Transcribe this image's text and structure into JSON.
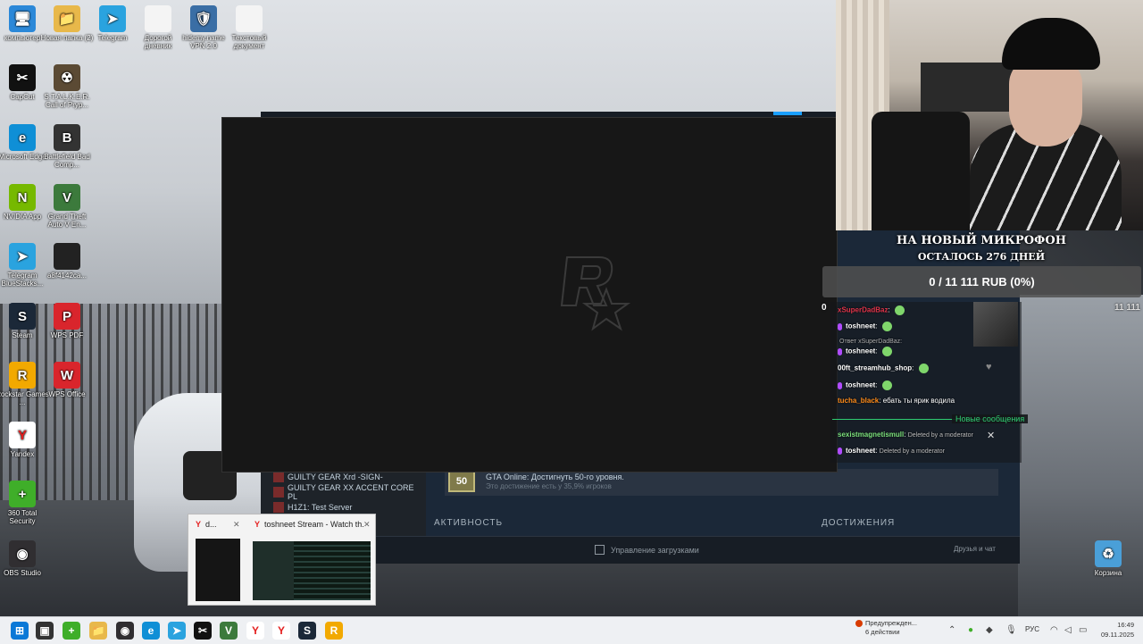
{
  "desktop": {
    "icons": [
      {
        "label": "компьютер",
        "symbol": "🖥",
        "bg": "#2b88d8"
      },
      {
        "label": "Новая папка (2)",
        "symbol": "📁",
        "bg": "#e8b84a"
      },
      {
        "label": "Telegram",
        "symbol": "➤",
        "bg": "#2aa3df"
      },
      {
        "label": "Дорогой дневник",
        "symbol": "",
        "bg": "#f4f4f4"
      },
      {
        "label": "hidemy.name VPN 2.0",
        "symbol": "🛡",
        "bg": "#3a6ea5"
      },
      {
        "label": "Текстовый документ",
        "symbol": "",
        "bg": "#f4f4f4"
      },
      {
        "label": "CapCut",
        "symbol": "✂",
        "bg": "#111111"
      },
      {
        "label": "S.T.A.L.K.E.R. Call of Pryp...",
        "symbol": "☢",
        "bg": "#5b4a34"
      },
      {
        "label": "Microsoft Edge",
        "symbol": "e",
        "bg": "#0f8fd6"
      },
      {
        "label": "Battlefield Bad Comp...",
        "symbol": "B",
        "bg": "#333333"
      },
      {
        "label": "NVIDIA App",
        "symbol": "N",
        "bg": "#76b900"
      },
      {
        "label": "Grand Theft Auto V En...",
        "symbol": "V",
        "bg": "#3c7a3c"
      },
      {
        "label": "Telegram BlueStacks...",
        "symbol": "➤",
        "bg": "#2aa3df"
      },
      {
        "label": "a8f4142ca...",
        "symbol": "",
        "bg": "#222222"
      },
      {
        "label": "Steam",
        "symbol": "S",
        "bg": "#1b2838"
      },
      {
        "label": "WPS PDF",
        "symbol": "P",
        "bg": "#d9252c"
      },
      {
        "label": "Rockstar Games ...",
        "symbol": "R",
        "bg": "#f2a900"
      },
      {
        "label": "WPS Office",
        "symbol": "W",
        "bg": "#d9252c"
      },
      {
        "label": "Yandex",
        "symbol": "Y",
        "bg": "#ffffff"
      },
      {
        "label": "360 Total Security",
        "symbol": "+",
        "bg": "#3fae29"
      },
      {
        "label": "OBS Studio",
        "symbol": "◉",
        "bg": "#302e31"
      },
      {
        "label": "Корзина",
        "symbol": "♻",
        "bg": "#4a9fd8"
      }
    ]
  },
  "steam": {
    "library_games": [
      "GUILTY GEAR Xrd -SIGN-",
      "GUILTY GEAR XX ACCENT CORE PL",
      "H1Z1: Test Server"
    ],
    "achievement": {
      "badge": "50",
      "title": "GTA Online: Достигнуть 50-го уровня.",
      "desc": "Это достижение есть у 35,9% игроков"
    },
    "section_activity": "АКТИВНОСТЬ",
    "section_achievements": "ДОСТИЖЕНИЯ",
    "downloads": "Управление загрузками",
    "friends": "Друзья и чат"
  },
  "stream": {
    "goal_title": "НА НОВЫЙ МИКРОФОН",
    "goal_subtitle": "ОСТАЛОСЬ 276 ДНЕЙ",
    "goal_progress_text": "0 / 11 111 RUB (0%)",
    "goal_progress_fraction": 0.0,
    "goal_min": "0",
    "goal_max": "11 111",
    "goal_color": "#6bd16b",
    "chat": [
      {
        "user": "xSuperDadBaz",
        "text": "",
        "color": "#e0344a",
        "mic": false,
        "emote": true
      },
      {
        "user": "toshneet",
        "text": "",
        "color": "#ffffff",
        "mic": true,
        "emote": true
      },
      {
        "user": "toshneet",
        "text": "",
        "color": "#ffffff",
        "mic": true,
        "emote": true
      },
      {
        "user": "00ft_streamhub_shop",
        "text": "",
        "color": "#ffffff",
        "mic": false,
        "emote": true
      },
      {
        "user": "toshneet",
        "text": "",
        "color": "#ffffff",
        "mic": true,
        "emote": true
      },
      {
        "user": "tucha_black",
        "text": "ебать ты ярик водила",
        "color": "#ff8c1a",
        "mic": false,
        "emote": false
      },
      {
        "user": "sexistmagnetismull",
        "text": "Deleted by a moderator",
        "color": "#7ce07c",
        "mic": false,
        "emote": false
      },
      {
        "user": "toshneet",
        "text": "Deleted by a moderator",
        "color": "#ffffff",
        "mic": true,
        "emote": false
      }
    ],
    "reply_text": "Ответ xSuperDadBaz:",
    "new_messages": "Новые сообщения"
  },
  "preview": {
    "tab1": "d...",
    "tab2": "toshneet Stream - Watch th..."
  },
  "taskbar": {
    "apps": [
      {
        "name": "windows-start",
        "symbol": "⊞",
        "bg": "#0a78d7"
      },
      {
        "name": "task-view",
        "symbol": "▣",
        "bg": "#333333"
      },
      {
        "name": "360-security",
        "symbol": "+",
        "bg": "#3fae29"
      },
      {
        "name": "file-explorer",
        "symbol": "📁",
        "bg": "#e8b84a"
      },
      {
        "name": "obs",
        "symbol": "◉",
        "bg": "#302e31"
      },
      {
        "name": "edge",
        "symbol": "e",
        "bg": "#0f8fd6"
      },
      {
        "name": "telegram",
        "symbol": "➤",
        "bg": "#2aa3df"
      },
      {
        "name": "capcut",
        "symbol": "✂",
        "bg": "#111111"
      },
      {
        "name": "gta-v",
        "symbol": "V",
        "bg": "#3c7a3c"
      },
      {
        "name": "yandex",
        "symbol": "Y",
        "bg": "#ffffff"
      },
      {
        "name": "yandex-2",
        "symbol": "Y",
        "bg": "#ffffff"
      },
      {
        "name": "steam",
        "symbol": "S",
        "bg": "#1b2838"
      },
      {
        "name": "rockstar",
        "symbol": "R",
        "bg": "#f2a900"
      }
    ],
    "alert_line1": "Предупрежден...",
    "alert_line2": "6 действии",
    "lang": "РУС",
    "time": "16:49",
    "date": "09.11.2025"
  }
}
